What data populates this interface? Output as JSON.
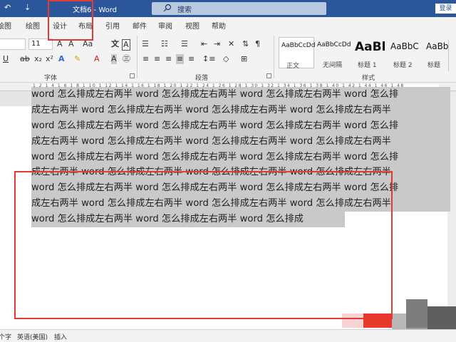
{
  "titlebar": {
    "doc_title": "文档6 - Word",
    "search_placeholder": "搜索",
    "login_label": "登录"
  },
  "tabs": [
    "绘图",
    "绘图",
    "设计",
    "布局",
    "引用",
    "邮件",
    "审阅",
    "视图",
    "帮助"
  ],
  "ribbon": {
    "font_size": "11",
    "groups": {
      "font": "字体",
      "paragraph": "段落",
      "styles": "样式"
    },
    "styles": [
      {
        "sample": "AaBbCcDd",
        "name": "正文"
      },
      {
        "sample": "AaBbCcDd",
        "name": "无间隔"
      },
      {
        "sample": "AaBl",
        "name": "标题 1"
      },
      {
        "sample": "AaBbC",
        "name": "标题 2"
      },
      {
        "sample": "AaBbC",
        "name": "标题"
      }
    ]
  },
  "ruler_text": "1 2 1 4 1 6 1 8 1 10 1 12 1 14 1 16 1 18 1 20 1 22 1 24 1 26 1 28 1 30 1 32 1 34 1 36 1 38 1 40 1 42 1 44 1 46 1 48",
  "document": {
    "lines": [
      "word 怎么排成左右两半 word 怎么排成左右两半 word 怎么排成左右两半 word 怎么排",
      "成左右两半 word 怎么排成左右两半 word 怎么排成左右两半 word 怎么排成左右两半",
      "word 怎么排成左右两半 word 怎么排成左右两半 word 怎么排成左右两半 word 怎么排",
      "成左右两半 word 怎么排成左右两半 word 怎么排成左右两半 word 怎么排成左右两半",
      "word 怎么排成左右两半 word 怎么排成左右两半 word 怎么排成左右两半 word 怎么排",
      "成左右两半 word 怎么排成左右两半 word 怎么排成左右两半 word 怎么排成左右两半",
      "word 怎么排成左右两半 word 怎么排成左右两半 word 怎么排成左右两半 word 怎么排",
      "成左右两半 word 怎么排成左右两半 word 怎么排成左右两半 word 怎么排成左右两半",
      "word 怎么排成左右两半 word 怎么排成左右两半 word 怎么排成"
    ]
  },
  "statusbar": {
    "words": "个字",
    "language": "英语(美国)",
    "mode": "插入"
  },
  "colors": {
    "title_bar": "#2b579a",
    "annotation": "#e53935",
    "selection": "#c9c9c9"
  }
}
